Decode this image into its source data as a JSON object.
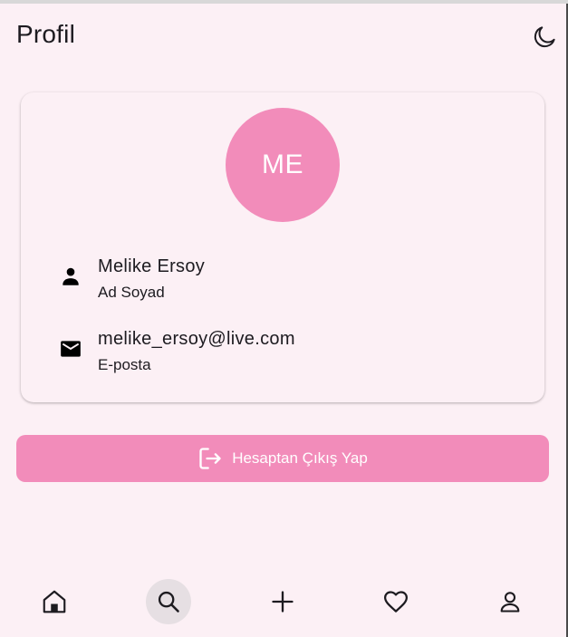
{
  "header": {
    "title": "Profil",
    "theme_toggle_icon": "moon-icon"
  },
  "profile": {
    "initials": "ME",
    "avatar_color": "#f28cba",
    "name": "Melike Ersoy",
    "name_label": "Ad Soyad",
    "name_icon": "person-icon",
    "email": "melike_ersoy@live.com",
    "email_label": "E-posta",
    "email_icon": "mail-icon"
  },
  "actions": {
    "logout_label": "Hesaptan Çıkış Yap",
    "logout_icon": "logout-icon",
    "logout_color": "#f28cba"
  },
  "bottom_nav": {
    "items": [
      {
        "icon": "home-icon",
        "active": false
      },
      {
        "icon": "search-icon",
        "active": true
      },
      {
        "icon": "add-icon",
        "active": false
      },
      {
        "icon": "heart-icon",
        "active": false
      },
      {
        "icon": "profile-icon",
        "active": false
      }
    ]
  },
  "colors": {
    "background": "#fcf0f5",
    "accent": "#f28cba",
    "active_nav_bg": "#e6dfe3"
  }
}
